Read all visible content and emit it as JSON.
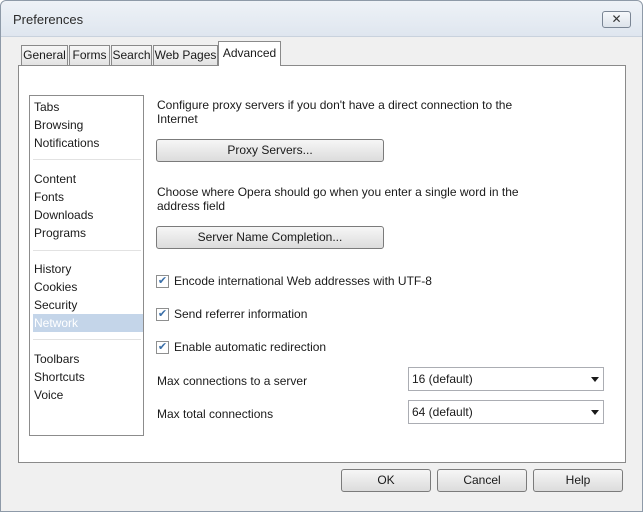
{
  "window": {
    "title": "Preferences",
    "close_glyph": "✕"
  },
  "tabs": [
    {
      "label": "General"
    },
    {
      "label": "Forms"
    },
    {
      "label": "Search"
    },
    {
      "label": "Web Pages"
    },
    {
      "label": "Advanced",
      "active": true
    }
  ],
  "sidebar": {
    "selected": "Network",
    "groups": [
      [
        "Tabs",
        "Browsing",
        "Notifications"
      ],
      [
        "Content",
        "Fonts",
        "Downloads",
        "Programs"
      ],
      [
        "History",
        "Cookies",
        "Security",
        "Network"
      ],
      [
        "Toolbars",
        "Shortcuts",
        "Voice"
      ]
    ]
  },
  "network": {
    "proxy_desc_1": "Configure proxy servers if you don't have a direct connection to the",
    "proxy_desc_2": "Internet",
    "proxy_button": "Proxy Servers...",
    "completion_desc_1": "Choose where Opera should go when you enter a single word in the",
    "completion_desc_2": "address field",
    "completion_button": "Server Name Completion...",
    "checkboxes": [
      {
        "label": "Encode international Web addresses with UTF-8",
        "checked": true
      },
      {
        "label": "Send referrer information",
        "checked": true
      },
      {
        "label": "Enable automatic redirection",
        "checked": true
      }
    ],
    "check_glyph": "✔",
    "max_conn_server_label": "Max connections to a server",
    "max_conn_server_value": "16 (default)",
    "max_total_label": "Max total connections",
    "max_total_value": "64 (default)"
  },
  "footer": {
    "ok": "OK",
    "cancel": "Cancel",
    "help": "Help"
  },
  "colors": {
    "selection": "#c4d5e9",
    "check": "#3b6fa8"
  }
}
